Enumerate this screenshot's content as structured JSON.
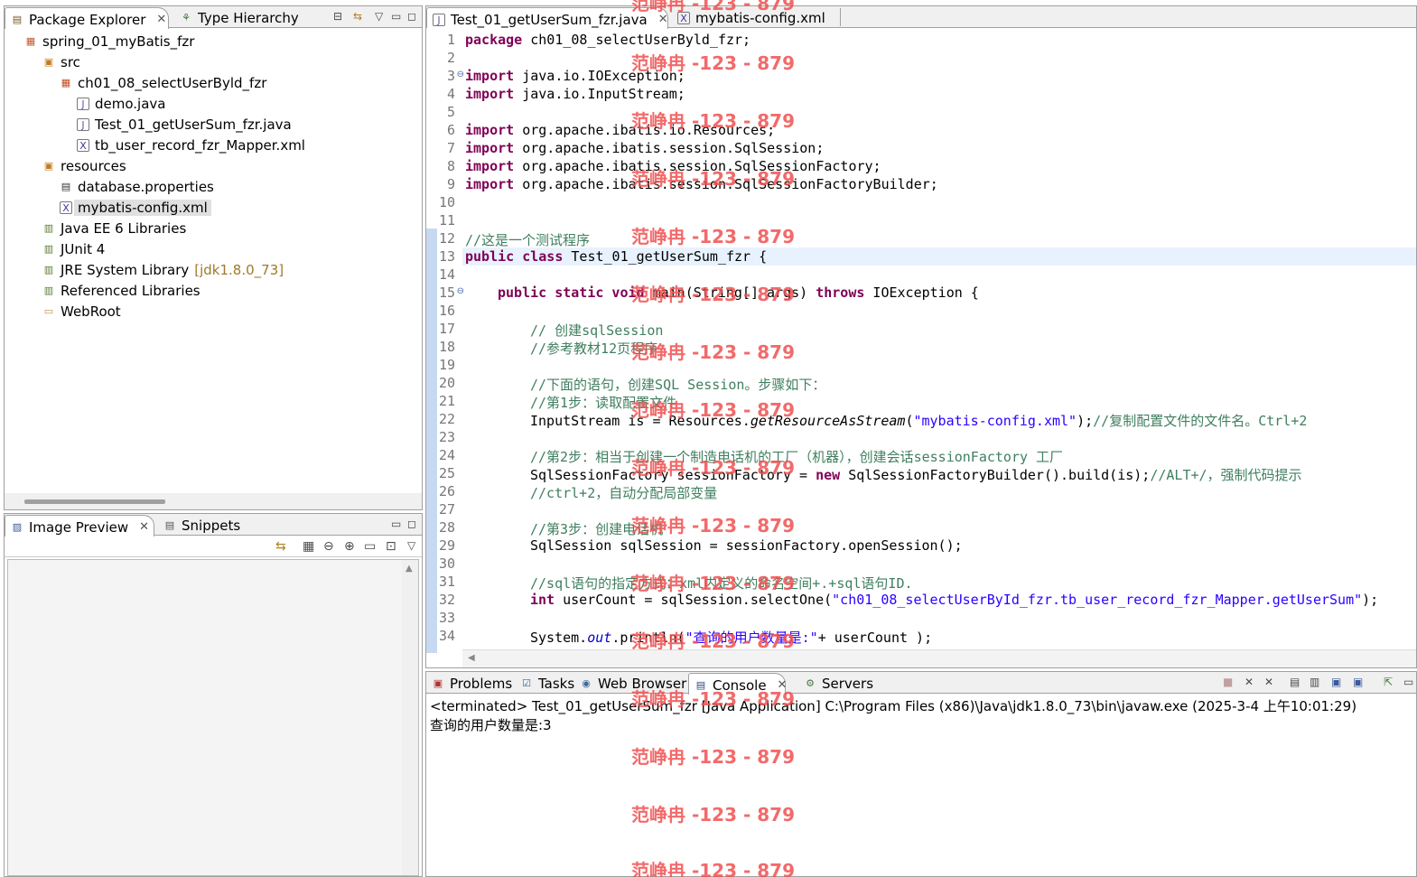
{
  "package_explorer": {
    "tabs": [
      {
        "label": "Package Explorer"
      },
      {
        "label": "Type Hierarchy"
      }
    ],
    "tree": [
      {
        "label": "spring_01_myBatis_fzr",
        "icon": "project-icon"
      },
      {
        "label": "src",
        "icon": "source-folder-icon"
      },
      {
        "label": "ch01_08_selectUserByld_fzr",
        "icon": "package-icon"
      },
      {
        "label": "demo.java",
        "icon": "java-file-icon"
      },
      {
        "label": "Test_01_getUserSum_fzr.java",
        "icon": "java-file-icon"
      },
      {
        "label": "tb_user_record_fzr_Mapper.xml",
        "icon": "xml-file-icon"
      },
      {
        "label": "resources",
        "icon": "source-folder-icon"
      },
      {
        "label": "database.properties",
        "icon": "properties-file-icon"
      },
      {
        "label": "mybatis-config.xml",
        "icon": "xml-file-icon"
      },
      {
        "label": "Java EE 6 Libraries",
        "icon": "library-icon"
      },
      {
        "label": "JUnit 4",
        "icon": "library-icon"
      },
      {
        "label": "JRE System Library",
        "suffix": "[jdk1.8.0_73]",
        "icon": "library-icon"
      },
      {
        "label": "Referenced Libraries",
        "icon": "library-icon"
      },
      {
        "label": "WebRoot",
        "icon": "folder-icon"
      }
    ]
  },
  "image_preview": {
    "tabs": [
      {
        "label": "Image Preview"
      },
      {
        "label": "Snippets"
      }
    ]
  },
  "editor": {
    "tabs": [
      {
        "label": "Test_01_getUserSum_fzr.java"
      },
      {
        "label": "mybatis-config.xml"
      }
    ],
    "line_numbers": [
      "1",
      "2",
      "3",
      "4",
      "5",
      "6",
      "7",
      "8",
      "9",
      "10",
      "11",
      "12",
      "13",
      "14",
      "15",
      "16",
      "17",
      "18",
      "19",
      "20",
      "21",
      "22",
      "23",
      "24",
      "25",
      "26",
      "27",
      "28",
      "29",
      "30",
      "31",
      "32",
      "33",
      "34"
    ],
    "code": {
      "l1_kw": "package",
      "l1_rest": " ch01_08_selectUserByld_fzr;",
      "l3_kw": "import",
      "l3_rest": " java.io.IOException;",
      "l4_kw": "import",
      "l4_rest": " java.io.InputStream;",
      "l6_kw": "import",
      "l6_rest": " org.apache.ibatis.io.Resources;",
      "l7_kw": "import",
      "l7_rest": " org.apache.ibatis.session.SqlSession;",
      "l8_kw": "import",
      "l8_rest": " org.apache.ibatis.session.SqlSessionFactory;",
      "l9_kw": "import",
      "l9_rest": " org.apache.ibatis.session.SqlSessionFactoryBuilder;",
      "l12_cm": "//这是一个测试程序",
      "l13_kw": "public class",
      "l13_rest": " Test_01_getUserSum_fzr {",
      "l15_kw": "public static void",
      "l15_mid": " main(String[] args) ",
      "l15_kw2": "throws",
      "l15_rest": " IOException {",
      "l17_cm": "// 创建sqlSession",
      "l18_cm": "//参考教材12页程序",
      "l20_cm": "//下面的语句，创建SQL Session。步骤如下：",
      "l21_cm": "//第1步：读取配置文件",
      "l22_a": "InputStream is = Resources.",
      "l22_it": "getResourceAsStream",
      "l22_b": "(",
      "l22_st": "\"mybatis-config.xml\"",
      "l22_c": ");",
      "l22_cm": "//复制配置文件的文件名。Ctrl+2",
      "l24_cm": "//第2步：相当于创建一个制造电话机的工厂（机器），创建会话sessionFactory 工厂",
      "l25_a": "SqlSessionFactory sessionFactory = ",
      "l25_kw": "new",
      "l25_b": " SqlSessionFactoryBuilder().build(is);",
      "l25_cm": "//ALT+/，强制代码提示",
      "l26_cm": "//ctrl+2，自动分配局部变量",
      "l28_cm": "//第3步：创建电话机",
      "l29": "SqlSession sqlSession = sessionFactory.openSession();",
      "l31_cm": "//sql语句的指定方式：xml内定义的命名空间+.+sql语句ID.",
      "l32_kw": "int",
      "l32_a": " userCount = sqlSession.selectOne(",
      "l32_st": "\"ch01_08_selectUserById_fzr.tb_user_record_fzr_Mapper.getUserSum\"",
      "l32_b": ");",
      "l34_a": "System.",
      "l34_fld": "out",
      "l34_b": ".println(",
      "l34_st": "\"查询的用户数量是:\"",
      "l34_c": "+ userCount );"
    }
  },
  "console": {
    "tabs": [
      {
        "label": "Problems"
      },
      {
        "label": "Tasks"
      },
      {
        "label": "Web Browser"
      },
      {
        "label": "Console"
      },
      {
        "label": "Servers"
      }
    ],
    "status": "<terminated> Test_01_getUserSum_fzr [Java Application] C:\\Program Files (x86)\\Java\\jdk1.8.0_73\\bin\\javaw.exe (2025-3-4 上午10:01:29)",
    "output": "查询的用户数量是:3"
  },
  "watermark": "范峥冉 -123 - 879",
  "colors": {
    "keyword": "#7f0055",
    "comment": "#3f7f5f",
    "string": "#2a00ff",
    "watermark": "#f05050"
  }
}
